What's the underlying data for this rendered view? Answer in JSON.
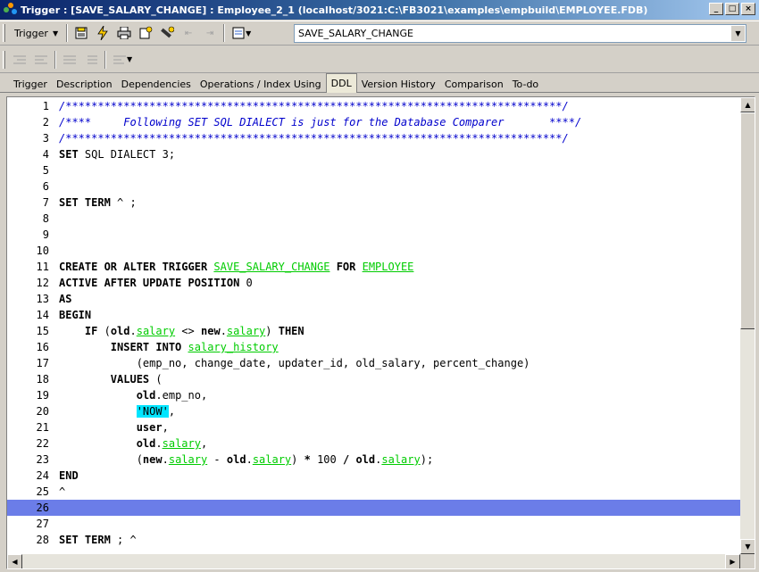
{
  "window": {
    "title": "Trigger : [SAVE_SALARY_CHANGE] : Employee_2_1 (localhost/3021:C:\\FB3021\\examples\\empbuild\\EMPLOYEE.FDB)",
    "buttons": {
      "minimize": "_",
      "maximize": "□",
      "close": "×"
    }
  },
  "toolbar": {
    "dropdown_label": "Trigger",
    "object_select_value": "SAVE_SALARY_CHANGE",
    "icons": [
      "save-icon",
      "compile-icon",
      "print-icon",
      "refresh-icon",
      "tools-icon",
      "prev-icon",
      "next-icon",
      "object-type-icon"
    ]
  },
  "tabs": [
    {
      "label": "Trigger",
      "active": false
    },
    {
      "label": "Description",
      "active": false
    },
    {
      "label": "Dependencies",
      "active": false
    },
    {
      "label": "Operations / Index Using",
      "active": false
    },
    {
      "label": "DDL",
      "active": true
    },
    {
      "label": "Version History",
      "active": false
    },
    {
      "label": "Comparison",
      "active": false
    },
    {
      "label": "To-do",
      "active": false
    }
  ],
  "editor": {
    "current_line": "26",
    "lines": [
      {
        "n": "1",
        "tokens": [
          [
            "cm",
            "/*****************************************************************************/"
          ]
        ]
      },
      {
        "n": "2",
        "tokens": [
          [
            "cm",
            "/****     Following SET SQL DIALECT is just for the Database Comparer       ****/"
          ]
        ]
      },
      {
        "n": "3",
        "tokens": [
          [
            "cm",
            "/*****************************************************************************/"
          ]
        ]
      },
      {
        "n": "4",
        "tokens": [
          [
            "kw",
            "SET"
          ],
          [
            "t",
            " SQL DIALECT 3;"
          ]
        ]
      },
      {
        "n": "5",
        "tokens": []
      },
      {
        "n": "6",
        "tokens": []
      },
      {
        "n": "7",
        "tokens": [
          [
            "kw",
            "SET TERM"
          ],
          [
            "t",
            " ^ ;"
          ]
        ]
      },
      {
        "n": "8",
        "tokens": []
      },
      {
        "n": "9",
        "tokens": []
      },
      {
        "n": "10",
        "tokens": []
      },
      {
        "n": "11",
        "tokens": [
          [
            "kw",
            "CREATE OR ALTER TRIGGER"
          ],
          [
            "t",
            " "
          ],
          [
            "id",
            "SAVE_SALARY_CHANGE"
          ],
          [
            "t",
            " "
          ],
          [
            "kw",
            "FOR"
          ],
          [
            "t",
            " "
          ],
          [
            "id",
            "EMPLOYEE"
          ]
        ]
      },
      {
        "n": "12",
        "tokens": [
          [
            "kw",
            "ACTIVE AFTER UPDATE POSITION"
          ],
          [
            "t",
            " 0"
          ]
        ]
      },
      {
        "n": "13",
        "tokens": [
          [
            "kw",
            "AS"
          ]
        ]
      },
      {
        "n": "14",
        "tokens": [
          [
            "kw",
            "BEGIN"
          ]
        ]
      },
      {
        "n": "15",
        "tokens": [
          [
            "t",
            "    "
          ],
          [
            "kw",
            "IF"
          ],
          [
            "t",
            " ("
          ],
          [
            "kw",
            "old"
          ],
          [
            "t",
            "."
          ],
          [
            "id",
            "salary"
          ],
          [
            "t",
            " <> "
          ],
          [
            "kw",
            "new"
          ],
          [
            "t",
            "."
          ],
          [
            "id",
            "salary"
          ],
          [
            "t",
            ") "
          ],
          [
            "kw",
            "THEN"
          ]
        ]
      },
      {
        "n": "16",
        "tokens": [
          [
            "t",
            "        "
          ],
          [
            "kw",
            "INSERT INTO"
          ],
          [
            "t",
            " "
          ],
          [
            "id",
            "salary_history"
          ]
        ]
      },
      {
        "n": "17",
        "tokens": [
          [
            "t",
            "            (emp_no, change_date, updater_id, old_salary, percent_change)"
          ]
        ]
      },
      {
        "n": "18",
        "tokens": [
          [
            "t",
            "        "
          ],
          [
            "kw",
            "VALUES"
          ],
          [
            "t",
            " ("
          ]
        ]
      },
      {
        "n": "19",
        "tokens": [
          [
            "t",
            "            "
          ],
          [
            "kw",
            "old"
          ],
          [
            "t",
            ".emp_no,"
          ]
        ]
      },
      {
        "n": "20",
        "tokens": [
          [
            "t",
            "            "
          ],
          [
            "str",
            "'NOW'"
          ],
          [
            "t",
            ","
          ]
        ]
      },
      {
        "n": "21",
        "tokens": [
          [
            "t",
            "            "
          ],
          [
            "kw",
            "user"
          ],
          [
            "t",
            ","
          ]
        ]
      },
      {
        "n": "22",
        "tokens": [
          [
            "t",
            "            "
          ],
          [
            "kw",
            "old"
          ],
          [
            "t",
            "."
          ],
          [
            "id",
            "salary"
          ],
          [
            "t",
            ","
          ]
        ]
      },
      {
        "n": "23",
        "tokens": [
          [
            "t",
            "            ("
          ],
          [
            "kw",
            "new"
          ],
          [
            "t",
            "."
          ],
          [
            "id",
            "salary"
          ],
          [
            "t",
            " - "
          ],
          [
            "kw",
            "old"
          ],
          [
            "t",
            "."
          ],
          [
            "id",
            "salary"
          ],
          [
            "t",
            ") "
          ],
          [
            "kw",
            "*"
          ],
          [
            "t",
            " 100 "
          ],
          [
            "kw",
            "/"
          ],
          [
            "t",
            " "
          ],
          [
            "kw",
            "old"
          ],
          [
            "t",
            "."
          ],
          [
            "id",
            "salary"
          ],
          [
            "t",
            ");"
          ]
        ]
      },
      {
        "n": "24",
        "tokens": [
          [
            "kw",
            "END"
          ]
        ]
      },
      {
        "n": "25",
        "tokens": [
          [
            "t",
            "^"
          ]
        ]
      },
      {
        "n": "26",
        "tokens": []
      },
      {
        "n": "27",
        "tokens": []
      },
      {
        "n": "28",
        "tokens": [
          [
            "kw",
            "SET TERM"
          ],
          [
            "t",
            " ; ^"
          ]
        ]
      }
    ]
  },
  "colors": {
    "keyword": "#000000",
    "comment": "#0000cc",
    "identifier": "#00cc00",
    "string_bg": "#00e5ff",
    "current_line": "#6b7de8"
  }
}
